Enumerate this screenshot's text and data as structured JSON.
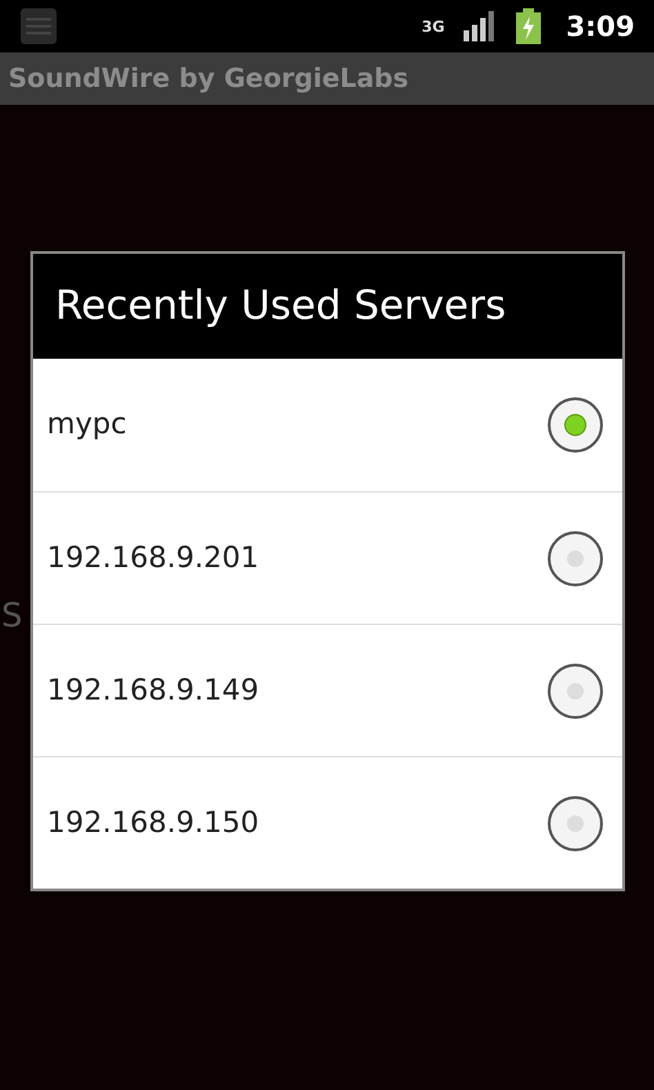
{
  "status_bar": {
    "network": "3G",
    "time": "3:09"
  },
  "app_bar": {
    "title": "SoundWire by GeorgieLabs"
  },
  "background_text": "S",
  "dialog": {
    "title": "Recently Used Servers",
    "servers": [
      {
        "label": "mypc",
        "selected": true
      },
      {
        "label": "192.168.9.201",
        "selected": false
      },
      {
        "label": "192.168.9.149",
        "selected": false
      },
      {
        "label": "192.168.9.150",
        "selected": false
      }
    ]
  }
}
